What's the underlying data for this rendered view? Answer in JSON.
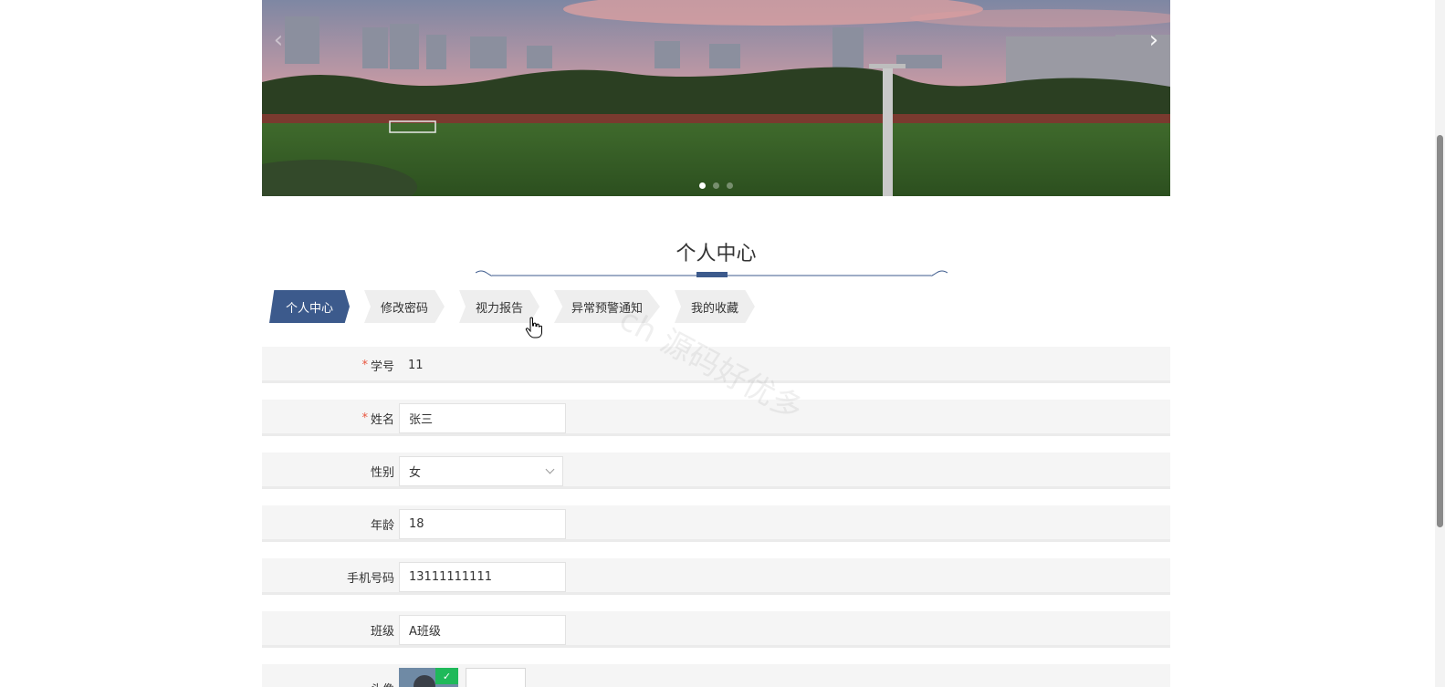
{
  "carousel": {
    "prev_icon": "chevron-left-icon",
    "next_icon": "chevron-right-icon",
    "slide_count": 3,
    "active_index": 0
  },
  "section": {
    "title": "个人中心"
  },
  "tabs": [
    {
      "label": "个人中心",
      "active": true
    },
    {
      "label": "修改密码",
      "active": false
    },
    {
      "label": "视力报告",
      "active": false
    },
    {
      "label": "异常预警通知",
      "active": false
    },
    {
      "label": "我的收藏",
      "active": false
    }
  ],
  "form": {
    "student_id": {
      "label": "学号",
      "required": true,
      "value": "11"
    },
    "name": {
      "label": "姓名",
      "required": true,
      "value": "张三"
    },
    "gender": {
      "label": "性别",
      "value": "女"
    },
    "age": {
      "label": "年龄",
      "value": "18"
    },
    "phone": {
      "label": "手机号码",
      "value": "13111111111"
    },
    "class": {
      "label": "班级",
      "value": "A班级"
    },
    "avatar": {
      "label": "头像"
    }
  },
  "watermark": "ch 源码好优多",
  "colors": {
    "accent": "#3c5a8c",
    "required": "#e8553e",
    "row_bg": "#f5f5f5",
    "success": "#1fb95a"
  }
}
